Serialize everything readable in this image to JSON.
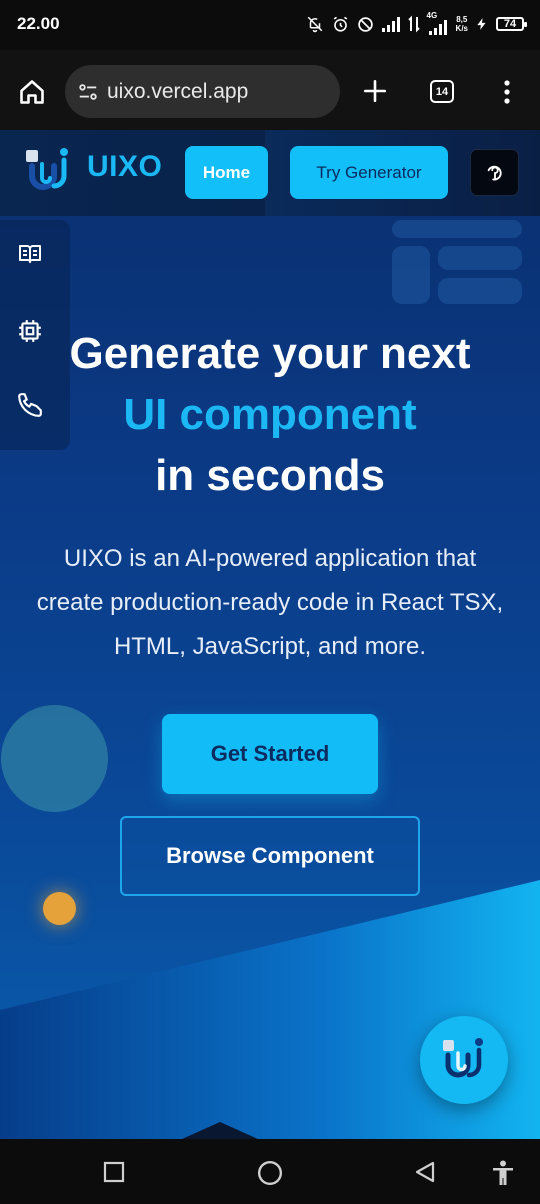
{
  "status_bar": {
    "time": "22.00",
    "net_speed_value": "8,5",
    "net_speed_unit": "K/s",
    "network_type": "4G",
    "battery": "74"
  },
  "browser": {
    "url": "uixo.vercel.app",
    "tab_count": "14"
  },
  "site": {
    "brand": "UIXO",
    "nav": {
      "home": "Home",
      "try_generator": "Try Generator"
    },
    "hero": {
      "title_line1": "Generate your next",
      "title_line2": "UI component",
      "title_line3": "in seconds",
      "subtitle": "UIXO is an AI-powered application that create production-ready code in React TSX, HTML, JavaScript, and more."
    },
    "buttons": {
      "get_started": "Get Started",
      "browse": "Browse Component"
    },
    "side_icons": [
      "book-icon",
      "chip-icon",
      "phone-icon"
    ],
    "colors": {
      "accent": "#12bdf7",
      "background_top": "#0a2f6e",
      "background_bottom": "#12b4f0",
      "dark_text": "#0b2a5e",
      "orange_dot": "#e6a23a"
    }
  }
}
